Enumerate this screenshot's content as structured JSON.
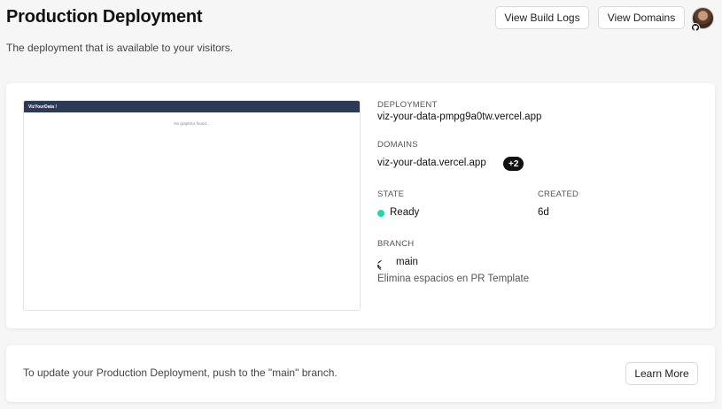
{
  "header": {
    "title": "Production Deployment",
    "subtitle": "The deployment that is available to your visitors.",
    "view_build_logs": "View Build Logs",
    "view_domains": "View Domains"
  },
  "preview": {
    "app_title": "VizYourData !",
    "empty_message": "No graphics found..."
  },
  "deployment": {
    "label": "DEPLOYMENT",
    "value": "viz-your-data-pmpg9a0tw.vercel.app"
  },
  "domains": {
    "label": "DOMAINS",
    "value": "viz-your-data.vercel.app",
    "extra_count": "+2"
  },
  "state": {
    "label": "STATE",
    "value": "Ready",
    "color": "#1ed8b0"
  },
  "created": {
    "label": "CREATED",
    "value": "6d"
  },
  "branch": {
    "label": "BRANCH",
    "name": "main",
    "commit_message": "Elimina espacios en PR Template"
  },
  "footer": {
    "message": "To update your Production Deployment, push to the \"main\" branch.",
    "learn_more": "Learn More"
  }
}
